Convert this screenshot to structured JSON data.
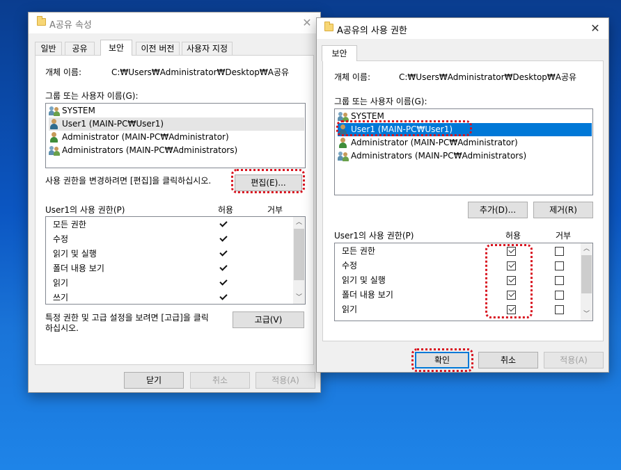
{
  "left_dialog": {
    "title": "A공유 속성",
    "tabs": [
      "일반",
      "공유",
      "보안",
      "이전 버전",
      "사용자 지정"
    ],
    "active_tab": "보안",
    "object_name_label": "개체 이름:",
    "object_name_value": "C:₩Users₩Administrator₩Desktop₩A공유",
    "group_label": "그룹 또는 사용자 이름(G):",
    "users": [
      {
        "name": "SYSTEM",
        "icon": "user-group-icon"
      },
      {
        "name": "User1 (MAIN-PC₩User1)",
        "icon": "user-icon"
      },
      {
        "name": "Administrator (MAIN-PC₩Administrator)",
        "icon": "user-icon"
      },
      {
        "name": "Administrators (MAIN-PC₩Administrators)",
        "icon": "user-group-icon"
      }
    ],
    "edit_hint": "사용 권한을 변경하려면 [편집]을 클릭하십시오.",
    "edit_button": "편집(E)...",
    "perm_label": "User1의 사용 권한(P)",
    "allow_header": "허용",
    "deny_header": "거부",
    "permissions": [
      {
        "name": "모든 권한",
        "allow": true,
        "deny": false
      },
      {
        "name": "수정",
        "allow": true,
        "deny": false
      },
      {
        "name": "읽기 및 실행",
        "allow": true,
        "deny": false
      },
      {
        "name": "폴더 내용 보기",
        "allow": true,
        "deny": false
      },
      {
        "name": "읽기",
        "allow": true,
        "deny": false
      },
      {
        "name": "쓰기",
        "allow": true,
        "deny": false
      }
    ],
    "advanced_hint_line1": "특정 권한 및 고급 설정을 보려면 [고급]을 클릭",
    "advanced_hint_line2": "하십시오.",
    "advanced_button": "고급(V)",
    "close_button": "닫기",
    "cancel_button": "취소",
    "apply_button": "적용(A)"
  },
  "right_dialog": {
    "title": "A공유의 사용 권한",
    "tab": "보안",
    "object_name_label": "개체 이름:",
    "object_name_value": "C:₩Users₩Administrator₩Desktop₩A공유",
    "group_label": "그룹 또는 사용자 이름(G):",
    "users": [
      {
        "name": "SYSTEM",
        "icon": "user-group-icon"
      },
      {
        "name": "User1 (MAIN-PC₩User1)",
        "icon": "user-icon",
        "selected": true
      },
      {
        "name": "Administrator (MAIN-PC₩Administrator)",
        "icon": "user-icon"
      },
      {
        "name": "Administrators (MAIN-PC₩Administrators)",
        "icon": "user-group-icon"
      }
    ],
    "add_button": "추가(D)...",
    "remove_button": "제거(R)",
    "perm_label": "User1의 사용 권한(P)",
    "allow_header": "허용",
    "deny_header": "거부",
    "permissions": [
      {
        "name": "모든 권한",
        "allow": true,
        "deny": false
      },
      {
        "name": "수정",
        "allow": true,
        "deny": false
      },
      {
        "name": "읽기 및 실행",
        "allow": true,
        "deny": false
      },
      {
        "name": "폴더 내용 보기",
        "allow": true,
        "deny": false
      },
      {
        "name": "읽기",
        "allow": true,
        "deny": false
      }
    ],
    "ok_button": "확인",
    "cancel_button": "취소",
    "apply_button": "적용(A)"
  },
  "colors": {
    "selection": "#0078d7",
    "highlight_annotation": "#d8121e",
    "desktop": "#0b56c2"
  }
}
